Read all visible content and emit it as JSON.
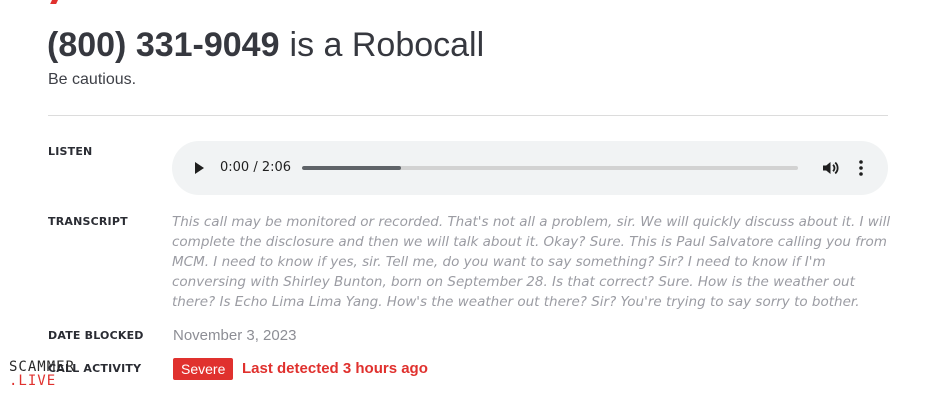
{
  "header": {
    "phone_number": "(800) 331-9049",
    "verdict": "is a Robocall",
    "subtitle": "Be cautious."
  },
  "sections": {
    "listen_label": "LISTEN",
    "transcript_label": "TRANSCRIPT",
    "date_blocked_label": "DATE BLOCKED",
    "activity_label": "CALL ACTIVITY"
  },
  "audio": {
    "time_display": "0:00 / 2:06",
    "progress_fraction": 0.2,
    "play_icon": "play-icon",
    "volume_icon": "volume-icon",
    "menu_icon": "more-vertical-icon"
  },
  "transcript": {
    "text": "This call may be monitored or recorded. That's not all a problem, sir. We will quickly discuss about it. I will complete the disclosure and then we will talk about it. Okay? Sure. This is Paul Salvatore calling you from MCM. I need to know if yes, sir. Tell me, do you want to say something? Sir? I need to know if I'm conversing with Shirley Bunton, born on September 28. Is that correct? Sure. How is the weather out there? Is Echo Lima Lima Yang. How's the weather out there? Sir? You're trying to say sorry to bother."
  },
  "date_blocked": {
    "value": "November 3, 2023"
  },
  "activity": {
    "badge": "Severe",
    "last_detected": "Last detected 3 hours ago"
  },
  "watermark": {
    "line1": "SCAMMER",
    "line2": ".LIVE"
  },
  "colors": {
    "accent": "#e0312e",
    "heading": "#36383f",
    "muted": "#9b9ca3",
    "player_bg": "#f1f3f4"
  }
}
